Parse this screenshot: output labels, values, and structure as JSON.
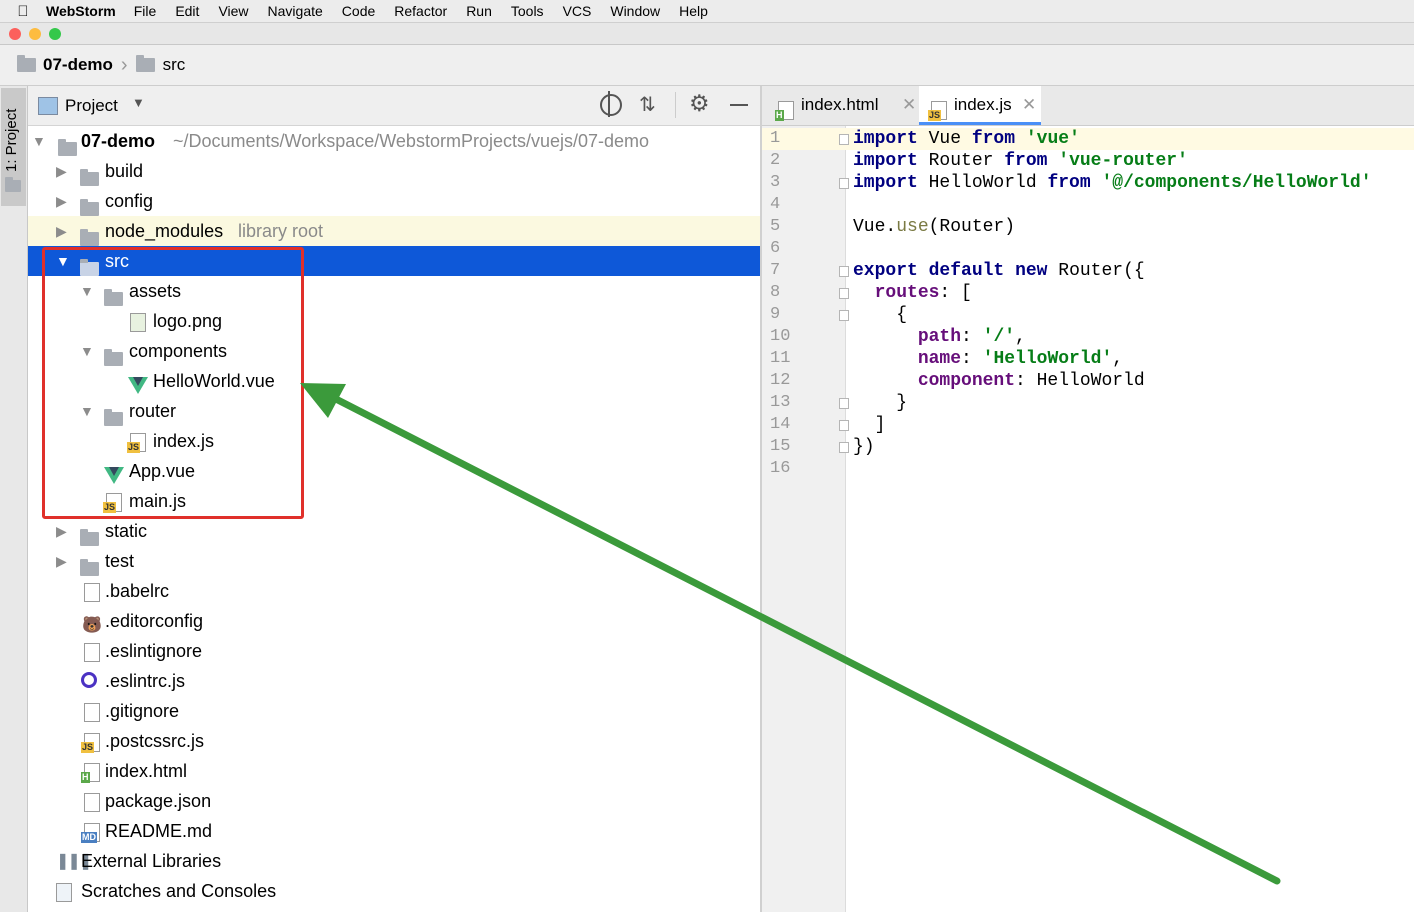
{
  "menubar": {
    "app_name": "WebStorm",
    "items": [
      "File",
      "Edit",
      "View",
      "Navigate",
      "Code",
      "Refactor",
      "Run",
      "Tools",
      "VCS",
      "Window",
      "Help"
    ]
  },
  "breadcrumb": {
    "project": "07-demo",
    "folder": "src"
  },
  "side_tab": {
    "label": "1: Project"
  },
  "project_header": {
    "title": "Project"
  },
  "tree": {
    "root": {
      "name": "07-demo",
      "path": "~/Documents/Workspace/WebstormProjects/vuejs/07-demo"
    },
    "items": [
      {
        "name": "build"
      },
      {
        "name": "config"
      },
      {
        "name": "node_modules",
        "hint": "library root"
      },
      {
        "name": "src"
      },
      {
        "name": "assets"
      },
      {
        "name": "logo.png"
      },
      {
        "name": "components"
      },
      {
        "name": "HelloWorld.vue"
      },
      {
        "name": "router"
      },
      {
        "name": "index.js"
      },
      {
        "name": "App.vue"
      },
      {
        "name": "main.js"
      },
      {
        "name": "static"
      },
      {
        "name": "test"
      },
      {
        "name": ".babelrc"
      },
      {
        "name": ".editorconfig"
      },
      {
        "name": ".eslintignore"
      },
      {
        "name": ".eslintrc.js"
      },
      {
        "name": ".gitignore"
      },
      {
        "name": ".postcssrc.js"
      },
      {
        "name": "index.html"
      },
      {
        "name": "package.json"
      },
      {
        "name": "README.md"
      },
      {
        "name": "External Libraries"
      },
      {
        "name": "Scratches and Consoles"
      }
    ]
  },
  "editor": {
    "tabs": [
      {
        "label": "index.html",
        "icon": "html-file-icon",
        "active": false
      },
      {
        "label": "index.js",
        "icon": "js-file-icon",
        "active": true
      }
    ],
    "line_numbers": [
      "1",
      "2",
      "3",
      "4",
      "5",
      "6",
      "7",
      "8",
      "9",
      "10",
      "11",
      "12",
      "13",
      "14",
      "15",
      "16"
    ],
    "lines": [
      [
        "kw:import",
        " Vue ",
        "kw:from",
        " ",
        "str:'vue'"
      ],
      [
        "kw:import",
        " Router ",
        "kw:from",
        " ",
        "str:'vue-router'"
      ],
      [
        "kw:import",
        " HelloWorld ",
        "kw:from",
        " ",
        "str:'@/components/HelloWorld'"
      ],
      [],
      [
        "Vue.",
        "fn:use",
        "(Router)"
      ],
      [],
      [
        "kw:export",
        " ",
        "kw:default",
        " ",
        "kw:new",
        " Router({"
      ],
      [
        "  ",
        "prop:routes",
        ": ["
      ],
      [
        "    {"
      ],
      [
        "      ",
        "prop:path",
        ": ",
        "str:'/'",
        ","
      ],
      [
        "      ",
        "prop:name",
        ": ",
        "str:'HelloWorld'",
        ","
      ],
      [
        "      ",
        "prop:component",
        ": HelloWorld"
      ],
      [
        "    }"
      ],
      [
        "  ]"
      ],
      [
        "})"
      ],
      []
    ]
  },
  "colors": {
    "selection": "#0e58d8",
    "annotation_box": "#e0302a",
    "annotation_arrow": "#3b9a3b",
    "keyword": "#000080",
    "string": "#067d17",
    "property": "#660e7a"
  }
}
